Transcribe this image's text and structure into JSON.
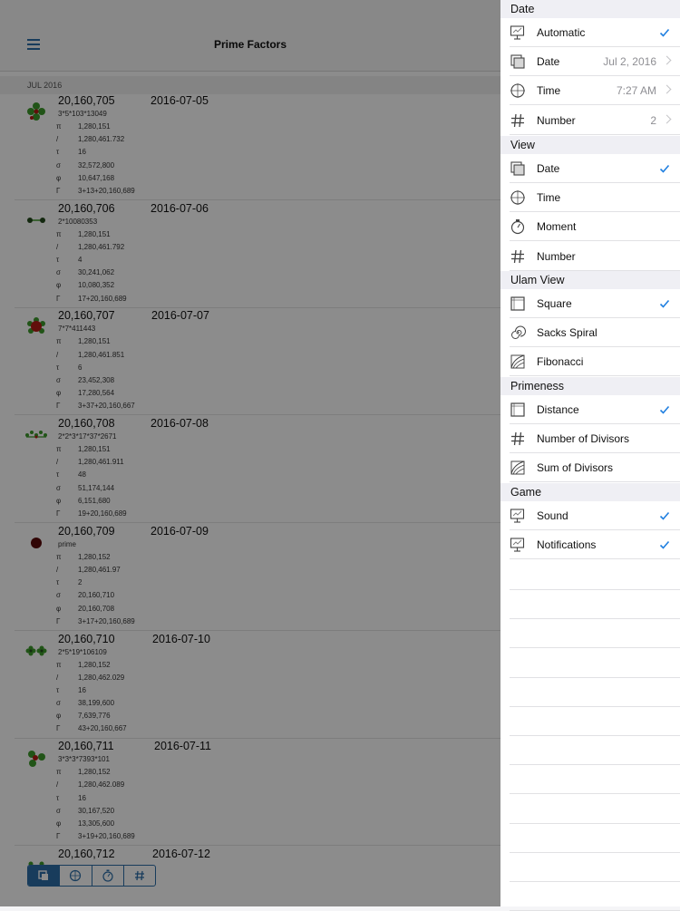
{
  "nav": {
    "title": "Prime Factors"
  },
  "list": {
    "section_header": "JUL 2016",
    "stat_symbols": [
      "π",
      "/",
      "τ",
      "σ",
      "φ",
      "Γ"
    ],
    "rows": [
      {
        "number": "20,160,705",
        "date": "2016-07-05",
        "factors": "3*5*103*13049",
        "icon": "four-petal-cluster-icon",
        "stats": [
          "1,280,151",
          "1,280,461.732",
          "16",
          "32,572,800",
          "10,647,168",
          "3+13+20,160,689"
        ]
      },
      {
        "number": "20,160,706",
        "date": "2016-07-06",
        "factors": "2*10080353",
        "icon": "two-dots-icon",
        "stats": [
          "1,280,151",
          "1,280,461.792",
          "4",
          "30,241,062",
          "10,080,352",
          "17+20,160,689"
        ]
      },
      {
        "number": "20,160,707",
        "date": "2016-07-07",
        "factors": "7*7*411443",
        "icon": "red-flower-icon",
        "stats": [
          "1,280,151",
          "1,280,461.851",
          "6",
          "23,452,308",
          "17,280,564",
          "3+37+20,160,667"
        ]
      },
      {
        "number": "20,160,708",
        "date": "2016-07-08",
        "factors": "2*2*3*17*37*2671",
        "icon": "dot-chain-icon",
        "stats": [
          "1,280,151",
          "1,280,461.911",
          "48",
          "51,174,144",
          "6,151,680",
          "19+20,160,689"
        ]
      },
      {
        "number": "20,160,709",
        "date": "2016-07-09",
        "factors": "prime",
        "icon": "single-dot-icon",
        "stats": [
          "1,280,152",
          "1,280,461.97",
          "2",
          "20,160,710",
          "20,160,708",
          "3+17+20,160,689"
        ]
      },
      {
        "number": "20,160,710",
        "date": "2016-07-10",
        "factors": "2*5*19*106109",
        "icon": "twin-flowers-icon",
        "stats": [
          "1,280,152",
          "1,280,462.029",
          "16",
          "38,199,600",
          "7,639,776",
          "43+20,160,667"
        ]
      },
      {
        "number": "20,160,711",
        "date": "2016-07-11",
        "factors": "3*3*3*7393*101",
        "icon": "trefoil-icon",
        "stats": [
          "1,280,152",
          "1,280,462.089",
          "16",
          "30,167,520",
          "13,305,600",
          "3+19+20,160,689"
        ]
      },
      {
        "number": "20,160,712",
        "date": "2016-07-12",
        "factors": "",
        "icon": "partial-icon",
        "stats": []
      }
    ]
  },
  "toolbar": {
    "segments": [
      {
        "icon": "date-view-icon",
        "selected": true
      },
      {
        "icon": "clock-icon",
        "selected": false
      },
      {
        "icon": "stopwatch-icon",
        "selected": false
      },
      {
        "icon": "hash-icon",
        "selected": false
      }
    ]
  },
  "settings": {
    "date_section": {
      "title": "Date",
      "items": [
        {
          "label": "Automatic",
          "value": "",
          "checked": true,
          "icon": "automatic-icon"
        },
        {
          "label": "Date",
          "value": "Jul 2, 2016",
          "checked": false,
          "icon": "calendar-icon"
        },
        {
          "label": "Time",
          "value": "7:27 AM",
          "checked": false,
          "icon": "clock-icon"
        },
        {
          "label": "Number",
          "value": "2",
          "checked": false,
          "icon": "hash-icon"
        }
      ]
    },
    "view_section": {
      "title": "View",
      "items": [
        {
          "label": "Date",
          "checked": true,
          "icon": "calendar-icon"
        },
        {
          "label": "Time",
          "checked": false,
          "icon": "clock-icon"
        },
        {
          "label": "Moment",
          "checked": false,
          "icon": "stopwatch-icon"
        },
        {
          "label": "Number",
          "checked": false,
          "icon": "hash-icon"
        }
      ]
    },
    "ulam_section": {
      "title": "Ulam View",
      "items": [
        {
          "label": "Square",
          "checked": true,
          "icon": "square-icon"
        },
        {
          "label": "Sacks Spiral",
          "checked": false,
          "icon": "spiral-icon"
        },
        {
          "label": "Fibonacci",
          "checked": false,
          "icon": "fibonacci-icon"
        }
      ]
    },
    "primeness_section": {
      "title": "Primeness",
      "items": [
        {
          "label": "Distance",
          "checked": true,
          "icon": "square-icon"
        },
        {
          "label": "Number of Divisors",
          "checked": false,
          "icon": "hash-icon"
        },
        {
          "label": "Sum of Divisors",
          "checked": false,
          "icon": "fibonacci-icon"
        }
      ]
    },
    "game_section": {
      "title": "Game",
      "items": [
        {
          "label": "Sound",
          "checked": true,
          "icon": "automatic-icon"
        },
        {
          "label": "Notifications",
          "checked": true,
          "icon": "automatic-icon"
        }
      ]
    }
  },
  "colors": {
    "accent": "#2d6ea8",
    "check": "#1f7fe0",
    "green": "#3d9a2b",
    "red": "#b31d14",
    "dark_red": "#5a0a0a"
  }
}
